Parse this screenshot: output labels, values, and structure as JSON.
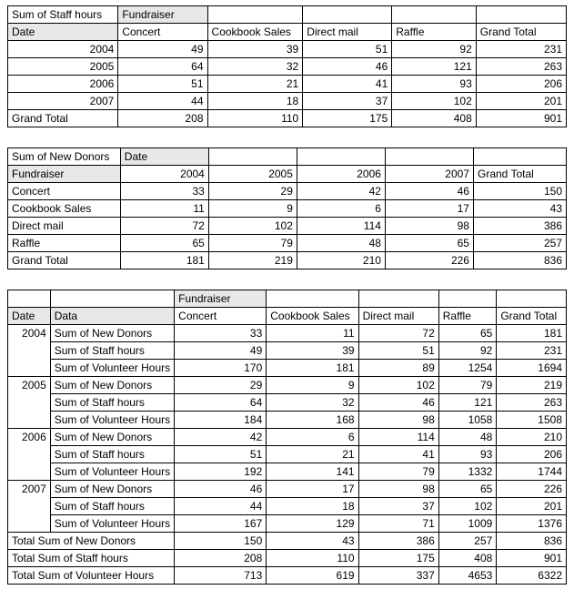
{
  "table1": {
    "corner": "Sum of Staff hours",
    "col_field_label": "Fundraiser",
    "row_field_label": "Date",
    "cols": [
      "Concert",
      "Cookbook Sales",
      "Direct mail",
      "Raffle",
      "Grand Total"
    ],
    "rows": [
      {
        "label": "2004",
        "vals": [
          49,
          39,
          51,
          92,
          231
        ]
      },
      {
        "label": "2005",
        "vals": [
          64,
          32,
          46,
          121,
          263
        ]
      },
      {
        "label": "2006",
        "vals": [
          51,
          21,
          41,
          93,
          206
        ]
      },
      {
        "label": "2007",
        "vals": [
          44,
          18,
          37,
          102,
          201
        ]
      }
    ],
    "total_label": "Grand Total",
    "totals": [
      208,
      110,
      175,
      408,
      901
    ]
  },
  "table2": {
    "corner": "Sum of New Donors",
    "col_field_label": "Date",
    "row_field_label": "Fundraiser",
    "cols": [
      "2004",
      "2005",
      "2006",
      "2007",
      "Grand Total"
    ],
    "rows": [
      {
        "label": "Concert",
        "vals": [
          33,
          29,
          42,
          46,
          150
        ]
      },
      {
        "label": "Cookbook Sales",
        "vals": [
          11,
          9,
          6,
          17,
          43
        ]
      },
      {
        "label": "Direct mail",
        "vals": [
          72,
          102,
          114,
          98,
          386
        ]
      },
      {
        "label": "Raffle",
        "vals": [
          65,
          79,
          48,
          65,
          257
        ]
      }
    ],
    "total_label": "Grand Total",
    "totals": [
      181,
      219,
      210,
      226,
      836
    ]
  },
  "table3": {
    "col_field_label": "Fundraiser",
    "row_fields": [
      "Date",
      "Data"
    ],
    "cols": [
      "Concert",
      "Cookbook Sales",
      "Direct mail",
      "Raffle",
      "Grand Total"
    ],
    "groups": [
      {
        "date": "2004",
        "rows": [
          {
            "label": "Sum of New Donors",
            "vals": [
              33,
              11,
              72,
              65,
              181
            ]
          },
          {
            "label": "Sum of Staff hours",
            "vals": [
              49,
              39,
              51,
              92,
              231
            ]
          },
          {
            "label": "Sum of Volunteer Hours",
            "vals": [
              170,
              181,
              89,
              1254,
              1694
            ]
          }
        ]
      },
      {
        "date": "2005",
        "rows": [
          {
            "label": "Sum of New Donors",
            "vals": [
              29,
              9,
              102,
              79,
              219
            ]
          },
          {
            "label": "Sum of Staff hours",
            "vals": [
              64,
              32,
              46,
              121,
              263
            ]
          },
          {
            "label": "Sum of Volunteer Hours",
            "vals": [
              184,
              168,
              98,
              1058,
              1508
            ]
          }
        ]
      },
      {
        "date": "2006",
        "rows": [
          {
            "label": "Sum of New Donors",
            "vals": [
              42,
              6,
              114,
              48,
              210
            ]
          },
          {
            "label": "Sum of Staff hours",
            "vals": [
              51,
              21,
              41,
              93,
              206
            ]
          },
          {
            "label": "Sum of Volunteer Hours",
            "vals": [
              192,
              141,
              79,
              1332,
              1744
            ]
          }
        ]
      },
      {
        "date": "2007",
        "rows": [
          {
            "label": "Sum of New Donors",
            "vals": [
              46,
              17,
              98,
              65,
              226
            ]
          },
          {
            "label": "Sum of Staff hours",
            "vals": [
              44,
              18,
              37,
              102,
              201
            ]
          },
          {
            "label": "Sum of Volunteer Hours",
            "vals": [
              167,
              129,
              71,
              1009,
              1376
            ]
          }
        ]
      }
    ],
    "totals": [
      {
        "label": "Total Sum of New Donors",
        "vals": [
          150,
          43,
          386,
          257,
          836
        ]
      },
      {
        "label": "Total Sum of Staff hours",
        "vals": [
          208,
          110,
          175,
          408,
          901
        ]
      },
      {
        "label": "Total Sum of Volunteer Hours",
        "vals": [
          713,
          619,
          337,
          4653,
          6322
        ]
      }
    ]
  }
}
